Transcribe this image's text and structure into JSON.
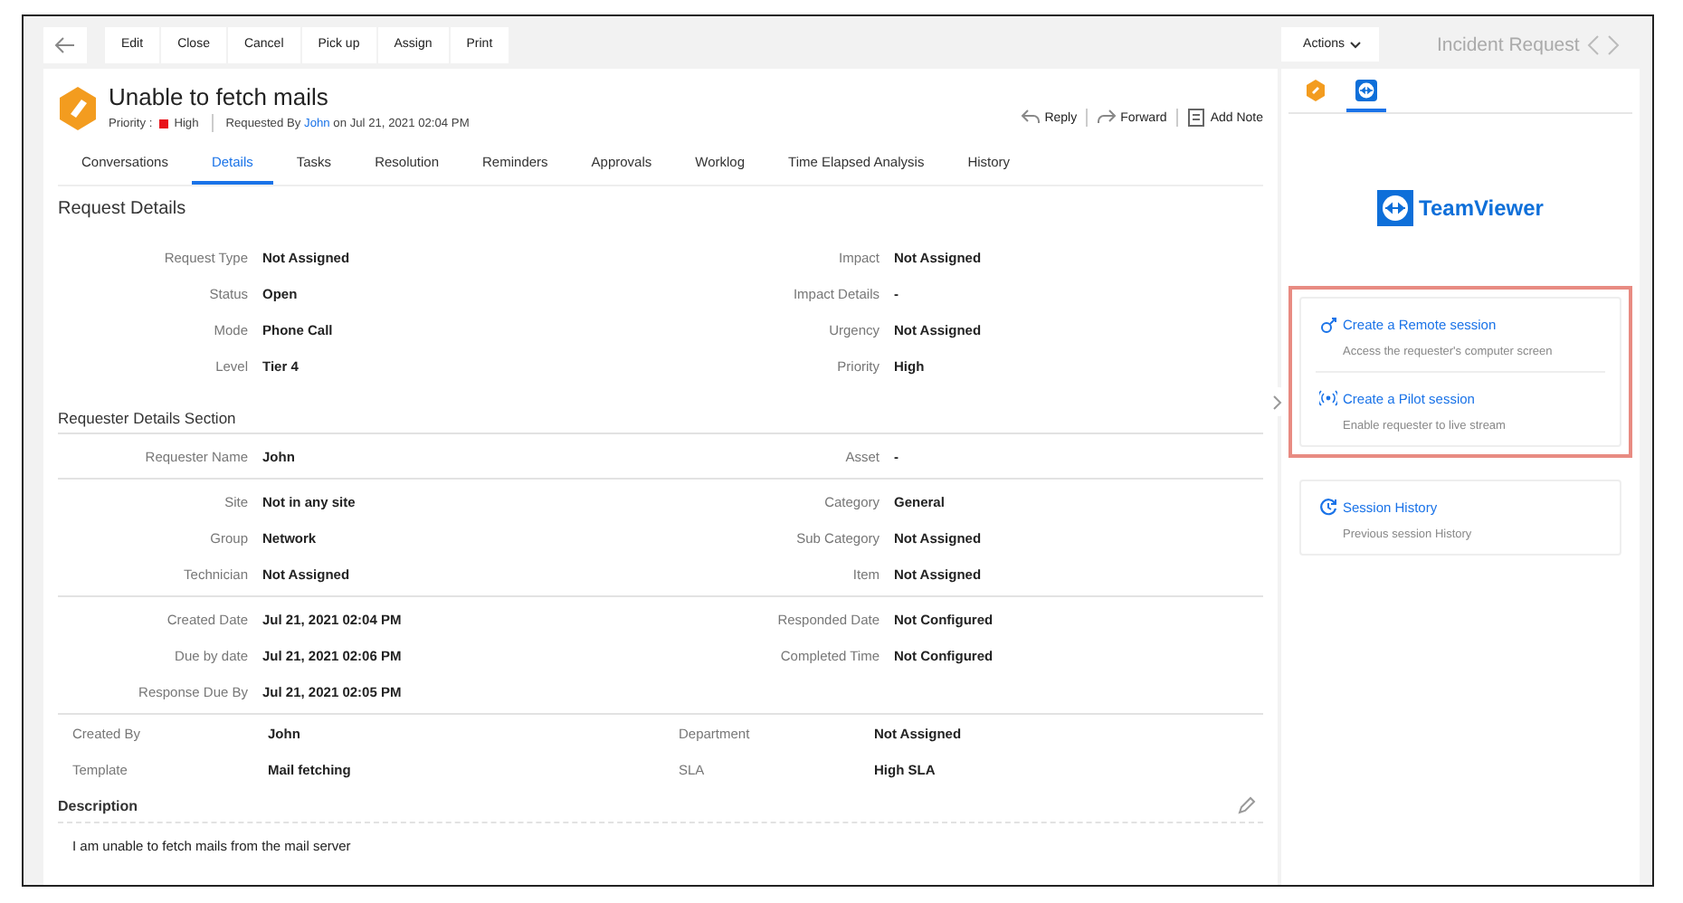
{
  "toolbar": {
    "buttons": [
      "Edit",
      "Close",
      "Cancel",
      "Pick up",
      "Assign",
      "Print"
    ],
    "actions": "Actions",
    "page_title": "Incident Request"
  },
  "request": {
    "title": "Unable to fetch mails",
    "priority_label": "Priority :",
    "priority": "High",
    "requested_by": "Requested By",
    "requester": "John",
    "date_text": "on Jul 21, 2021 02:04 PM",
    "actions": [
      {
        "kind": "reply",
        "label": "Reply"
      },
      {
        "kind": "forward",
        "label": "Forward"
      },
      {
        "kind": "note",
        "label": "Add Note"
      }
    ]
  },
  "tabs": [
    {
      "label": "Conversations",
      "selected": false
    },
    {
      "label": "Details",
      "selected": true
    },
    {
      "label": "Tasks",
      "selected": false
    },
    {
      "label": "Resolution",
      "selected": false
    },
    {
      "label": "Reminders",
      "selected": false
    },
    {
      "label": "Approvals",
      "selected": false
    },
    {
      "label": "Worklog",
      "selected": false
    },
    {
      "label": "Time Elapsed Analysis",
      "selected": false
    },
    {
      "label": "History",
      "selected": false
    }
  ],
  "request_details": {
    "title": "Request Details",
    "rows": [
      [
        {
          "label": "Request Type",
          "value": "Not Assigned"
        },
        {
          "label": "Impact",
          "value": "Not Assigned"
        }
      ],
      [
        {
          "label": "Status",
          "value": "Open"
        },
        {
          "label": "Impact Details",
          "value": "-"
        }
      ],
      [
        {
          "label": "Mode",
          "value": "Phone Call"
        },
        {
          "label": "Urgency",
          "value": "Not Assigned"
        }
      ],
      [
        {
          "label": "Level",
          "value": "Tier 4"
        },
        {
          "label": "Priority",
          "value": "High"
        }
      ]
    ]
  },
  "requester_details": {
    "title": "Requester Details Section",
    "groups": [
      [
        [
          {
            "label": "Requester Name",
            "value": "John"
          },
          {
            "label": "Asset",
            "value": "-"
          }
        ]
      ],
      [
        [
          {
            "label": "Site",
            "value": "Not in any site"
          },
          {
            "label": "Category",
            "value": "General"
          }
        ],
        [
          {
            "label": "Group",
            "value": "Network"
          },
          {
            "label": "Sub Category",
            "value": "Not Assigned"
          }
        ],
        [
          {
            "label": "Technician",
            "value": "Not Assigned"
          },
          {
            "label": "Item",
            "value": "Not Assigned"
          }
        ]
      ],
      [
        [
          {
            "label": "Created Date",
            "value": "Jul 21, 2021 02:04 PM"
          },
          {
            "label": "Responded Date",
            "value": "Not Configured"
          }
        ],
        [
          {
            "label": "Due by date",
            "value": "Jul 21, 2021 02:06 PM"
          },
          {
            "label": "Completed Time",
            "value": "Not Configured"
          }
        ],
        [
          {
            "label": "Response Due By",
            "value": "Jul 21, 2021 02:05 PM"
          }
        ]
      ]
    ]
  },
  "other_fields": [
    [
      {
        "label": "Created By",
        "value": "John"
      },
      {
        "label": "Department",
        "value": "Not Assigned"
      }
    ],
    [
      {
        "label": "Template",
        "value": "Mail fetching"
      },
      {
        "label": "SLA",
        "value": "High SLA"
      }
    ]
  ],
  "description": {
    "title": "Description",
    "text": "I am unable to fetch mails from the mail server"
  },
  "side_panel": {
    "tabs": [
      {
        "kind": "ticket",
        "selected": false
      },
      {
        "kind": "teamviewer",
        "selected": true
      }
    ],
    "logo": "TeamViewer",
    "cards": [
      {
        "highlighted": true,
        "items": [
          {
            "kind": "remote",
            "title": "Create a Remote session",
            "subtitle": "Access the requester's computer screen"
          },
          {
            "kind": "pilot",
            "title": "Create a Pilot session",
            "subtitle": "Enable requester to live stream"
          }
        ]
      },
      {
        "highlighted": false,
        "items": [
          {
            "kind": "history",
            "title": "Session History",
            "subtitle": "Previous session History"
          }
        ]
      }
    ]
  }
}
